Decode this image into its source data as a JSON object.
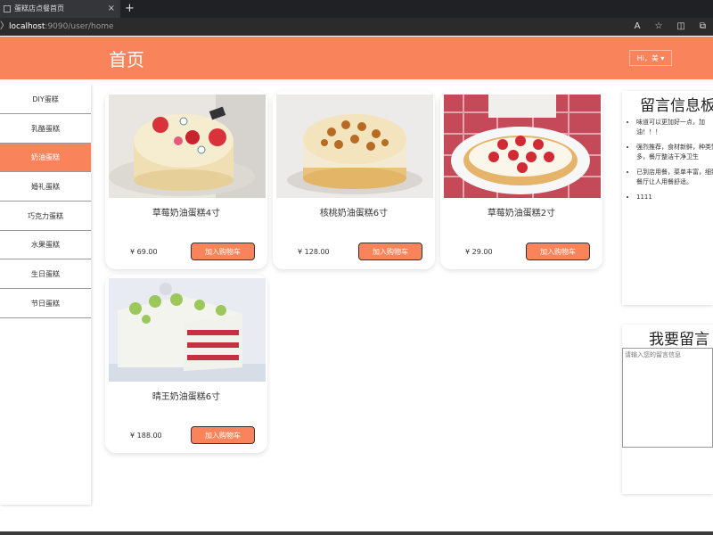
{
  "browser": {
    "tab_title": "蛋糕店点餐首页",
    "tab_close": "×",
    "new_tab": "+",
    "reload": "〉",
    "url_host": "localhost",
    "url_path": ":9090/user/home",
    "read_aloud": "A",
    "favorite": "☆",
    "split": "◫",
    "collections": "⧉"
  },
  "header": {
    "title": "首页",
    "user_menu": "Hi，美 ▾",
    "color": "#f9845b"
  },
  "sidebar": {
    "items": [
      {
        "label": "DIY蛋糕"
      },
      {
        "label": "乳酪蛋糕"
      },
      {
        "label": "奶油蛋糕"
      },
      {
        "label": "婚礼蛋糕"
      },
      {
        "label": "巧克力蛋糕"
      },
      {
        "label": "水果蛋糕"
      },
      {
        "label": "生日蛋糕"
      },
      {
        "label": "节日蛋糕"
      }
    ],
    "active": "奶油蛋糕"
  },
  "products": [
    {
      "name": "草莓奶油蛋糕4寸",
      "price": "¥ 69.00",
      "button": "加入购物车"
    },
    {
      "name": "核桃奶油蛋糕6寸",
      "price": "¥ 128.00",
      "button": "加入购物车"
    },
    {
      "name": "草莓奶油蛋糕2寸",
      "price": "¥ 29.00",
      "button": "加入购物车"
    },
    {
      "name": "晴王奶油蛋糕6寸",
      "price": "¥ 188.00",
      "button": "加入购物车"
    }
  ],
  "messages": {
    "title": "留言信息板",
    "items": [
      "味道可以更加好一点，加油！！！",
      "强烈推荐，食材新鲜，种类繁多，餐厅整洁干净卫生",
      "已到店用餐，菜单丰富，细致，餐厅让人用餐舒适。",
      "1111"
    ]
  },
  "write": {
    "title": "我要留言",
    "placeholder": "请输入您的留言信息"
  }
}
